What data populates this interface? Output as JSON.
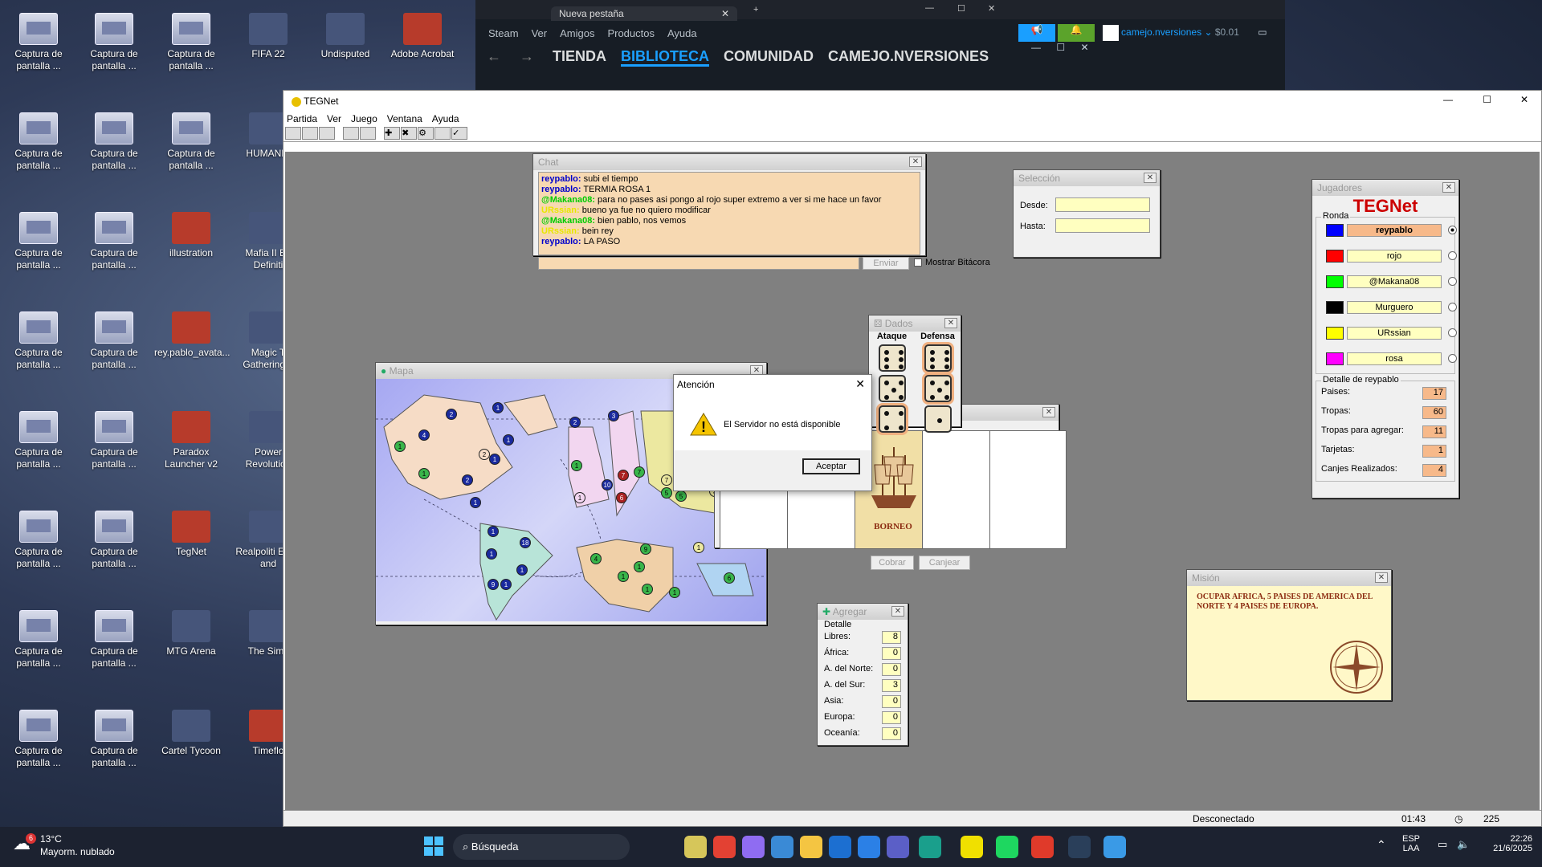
{
  "desktop": {
    "icons": [
      {
        "label": "Captura de pantalla ...",
        "kind": "thumb"
      },
      {
        "label": "Captura de pantalla ...",
        "kind": "thumb"
      },
      {
        "label": "Captura de pantalla ...",
        "kind": "thumb"
      },
      {
        "label": "FIFA 22",
        "kind": "game"
      },
      {
        "label": "Undisputed",
        "kind": "game"
      },
      {
        "label": "Adobe Acrobat",
        "kind": "app"
      },
      {
        "label": "Captura de pantalla ...",
        "kind": "thumb"
      },
      {
        "label": "Captura de pantalla ...",
        "kind": "thumb"
      },
      {
        "label": "Captura de pantalla ...",
        "kind": "thumb"
      },
      {
        "label": "HUMANKI",
        "kind": "game"
      },
      {
        "label": "Captura de pantalla ...",
        "kind": "thumb"
      },
      {
        "label": "Captura de pantalla ...",
        "kind": "thumb"
      },
      {
        "label": "illustration",
        "kind": "app"
      },
      {
        "label": "Mafia II Ed Definiti",
        "kind": "game"
      },
      {
        "label": "Captura de pantalla ...",
        "kind": "thumb"
      },
      {
        "label": "Captura de pantalla ...",
        "kind": "thumb"
      },
      {
        "label": "rey.pablo_avata...",
        "kind": "app"
      },
      {
        "label": "Magic T Gathering A",
        "kind": "game"
      },
      {
        "label": "Captura de pantalla ...",
        "kind": "thumb"
      },
      {
        "label": "Captura de pantalla ...",
        "kind": "thumb"
      },
      {
        "label": "Paradox Launcher v2",
        "kind": "app"
      },
      {
        "label": "Power Revolution",
        "kind": "game"
      },
      {
        "label": "Captura de pantalla ...",
        "kind": "thumb"
      },
      {
        "label": "Captura de pantalla ...",
        "kind": "thumb"
      },
      {
        "label": "TegNet",
        "kind": "app"
      },
      {
        "label": "Realpoliti Earth and",
        "kind": "game"
      },
      {
        "label": "Captura de pantalla ...",
        "kind": "thumb"
      },
      {
        "label": "Captura de pantalla ...",
        "kind": "thumb"
      },
      {
        "label": "MTG Arena",
        "kind": "game"
      },
      {
        "label": "The Sims",
        "kind": "game"
      },
      {
        "label": "Captura de pantalla ...",
        "kind": "thumb"
      },
      {
        "label": "Captura de pantalla ...",
        "kind": "thumb"
      },
      {
        "label": "Cartel Tycoon",
        "kind": "game"
      },
      {
        "label": "Timeflo",
        "kind": "app"
      }
    ]
  },
  "steam": {
    "tab": "Nueva pestaña",
    "menu": [
      "Steam",
      "Ver",
      "Amigos",
      "Productos",
      "Ayuda"
    ],
    "nav": [
      "TIENDA",
      "BIBLIOTECA",
      "COMUNIDAD",
      "CAMEJO.NVERSIONES"
    ],
    "active_nav": "BIBLIOTECA",
    "account": "camejo.nversiones",
    "wallet": "$0.01"
  },
  "teg": {
    "title": "TEGNet",
    "menu": [
      "Partida",
      "Ver",
      "Juego",
      "Ventana",
      "Ayuda"
    ],
    "chat": {
      "title": "Chat",
      "lines": [
        {
          "user": "reypablo:",
          "text": "subi el tiempo",
          "color": "#0000cc"
        },
        {
          "user": "reypablo:",
          "text": "TERMIA ROSA 1",
          "color": "#0000cc"
        },
        {
          "user": "@Makana08:",
          "text": "para no pases asi pongo al rojo super extremo a ver si me hace un favor",
          "color": "#00cc00"
        },
        {
          "user": "URssian:",
          "text": "bueno ya fue no quiero modificar",
          "color": "#e8e800"
        },
        {
          "user": "@Makana08:",
          "text": "bien pablo, nos vemos",
          "color": "#00cc00"
        },
        {
          "user": "URssian:",
          "text": "bein rey",
          "color": "#e8e800"
        },
        {
          "user": "reypablo:",
          "text": "LA PASO",
          "color": "#0000cc"
        }
      ],
      "send": "Enviar",
      "log": "Mostrar Bitácora"
    },
    "seleccion": {
      "title": "Selección",
      "from": "Desde:",
      "to": "Hasta:"
    },
    "dados": {
      "title": "Dados",
      "attack": "Ataque",
      "defense": "Defensa"
    },
    "map": {
      "title": "Mapa"
    },
    "players": {
      "title": "Jugadores",
      "logo": "TEGNet",
      "round": "Ronda",
      "list": [
        {
          "name": "reypablo",
          "color": "#0000ff",
          "active": true
        },
        {
          "name": "rojo",
          "color": "#ff0000",
          "active": false
        },
        {
          "name": "@Makana08",
          "color": "#00ff00",
          "active": false
        },
        {
          "name": "Murguero",
          "color": "#000000",
          "active": false
        },
        {
          "name": "URssian",
          "color": "#ffff00",
          "active": false
        },
        {
          "name": "rosa",
          "color": "#ff00ff",
          "active": false
        }
      ],
      "detail_title": "Detalle de reypablo",
      "detail": [
        {
          "label": "Paises:",
          "value": "17"
        },
        {
          "label": "Tropas:",
          "value": "60"
        },
        {
          "label": "Tropas para agregar:",
          "value": "11"
        },
        {
          "label": "Tarjetas:",
          "value": "1"
        },
        {
          "label": "Canjes Realizados:",
          "value": "4"
        }
      ]
    },
    "cards": {
      "card_name": "BORNEO",
      "cobrar": "Cobrar",
      "canjear": "Canjear"
    },
    "agregar": {
      "title": "Agregar",
      "detail": "Detalle",
      "rows": [
        {
          "label": "Libres:",
          "value": "8"
        },
        {
          "label": "África:",
          "value": "0"
        },
        {
          "label": "A. del Norte:",
          "value": "0"
        },
        {
          "label": "A. del Sur:",
          "value": "3"
        },
        {
          "label": "Asia:",
          "value": "0"
        },
        {
          "label": "Europa:",
          "value": "0"
        },
        {
          "label": "Oceanía:",
          "value": "0"
        }
      ]
    },
    "mision": {
      "title": "Misión",
      "text": "OCUPAR AFRICA, 5 PAISES DE AMERICA DEL NORTE Y 4 PAISES DE EUROPA."
    },
    "status": {
      "connection": "Desconectado",
      "time": "01:43",
      "count": "225"
    },
    "dialog": {
      "title": "Atención",
      "message": "El Servidor no está disponible",
      "ok": "Aceptar"
    }
  },
  "taskbar": {
    "weather_temp": "13°C",
    "weather_desc": "Mayorm. nublado",
    "weather_badge": "6",
    "search": "Búsqueda",
    "lang1": "ESP",
    "lang2": "LAA",
    "time": "22:26",
    "date": "21/6/2025"
  }
}
